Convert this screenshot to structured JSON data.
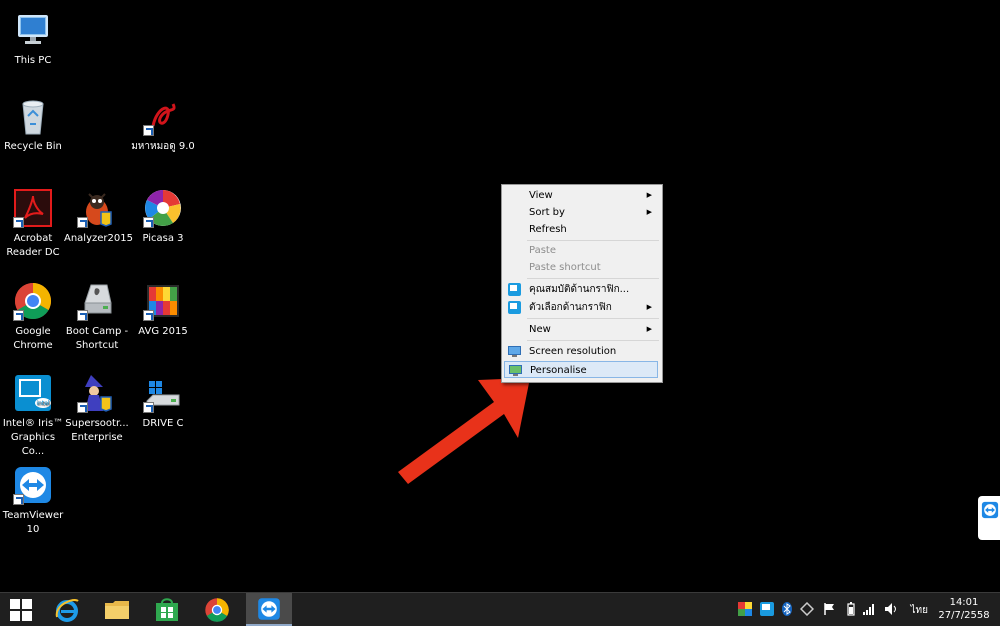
{
  "desktop_icons": [
    {
      "label": "This PC"
    },
    {
      "label": "Recycle Bin"
    },
    {
      "label": "มหาหมอดู 9.0"
    },
    {
      "label": "Acrobat Reader DC"
    },
    {
      "label": "Analyzer2015"
    },
    {
      "label": "Picasa 3"
    },
    {
      "label": "Google Chrome"
    },
    {
      "label": "Boot Camp - Shortcut"
    },
    {
      "label": "AVG 2015"
    },
    {
      "label": "Intel® Iris™ Graphics Co..."
    },
    {
      "label": "Supersootr... Enterprise"
    },
    {
      "label": "DRIVE C"
    },
    {
      "label": "TeamViewer 10"
    }
  ],
  "context_menu": {
    "view": "View",
    "sort_by": "Sort by",
    "refresh": "Refresh",
    "paste": "Paste",
    "paste_shortcut": "Paste shortcut",
    "graphics_properties": "คุณสมบัติด้านกราฟิก...",
    "graphics_options": "ตัวเลือกด้านกราฟิก",
    "new": "New",
    "screen_resolution": "Screen resolution",
    "personalise": "Personalise",
    "submenu_arrow": "▶"
  },
  "taskbar": {
    "pinned": [
      "start-button",
      "internet-explorer-icon",
      "file-explorer-icon",
      "windows-store-icon",
      "chrome-icon",
      "teamviewer-icon"
    ],
    "language": "ไทย",
    "time": "14:01",
    "date": "27/7/2558"
  },
  "colors": {
    "arrow": "#e8321a",
    "menu_highlight": "#dce9f7",
    "desktop": "#000000"
  }
}
